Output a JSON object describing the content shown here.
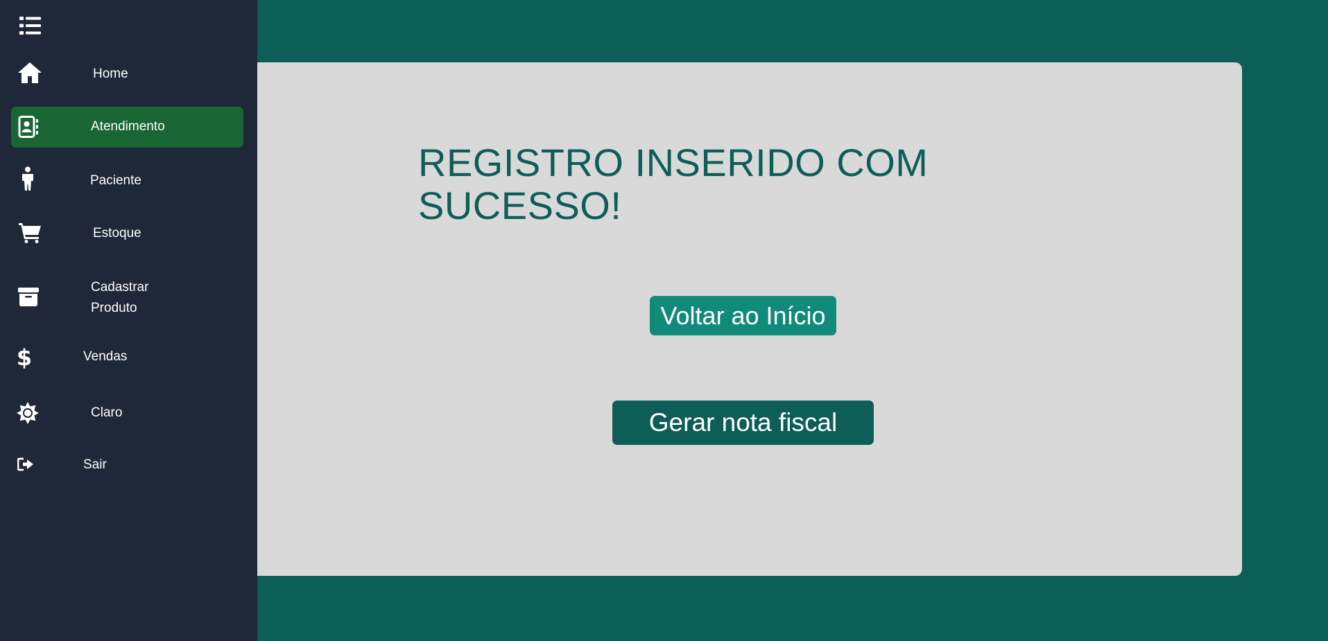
{
  "sidebar": {
    "toggle_icon": "list-icon",
    "items": [
      {
        "label": "Home",
        "icon": "home-icon",
        "active": false
      },
      {
        "label": "Atendimento",
        "icon": "contact-book-icon",
        "active": true
      },
      {
        "label": "Paciente",
        "icon": "person-icon",
        "active": false
      },
      {
        "label": "Estoque",
        "icon": "cart-icon",
        "active": false
      },
      {
        "label": "Cadastrar Produto",
        "icon": "archive-box-icon",
        "active": false
      },
      {
        "label": "Vendas",
        "icon": "dollar-icon",
        "active": false
      },
      {
        "label": "Claro",
        "icon": "sun-icon",
        "active": false
      },
      {
        "label": "Sair",
        "icon": "sign-out-icon",
        "active": false
      }
    ]
  },
  "main": {
    "message": "REGISTRO INSERIDO COM SUCESSO!",
    "home_button": "Voltar ao Início",
    "invoice_button": "Gerar nota fiscal"
  },
  "colors": {
    "background": "#0d5e56",
    "sidebar": "#1f2838",
    "active_item": "#196634",
    "panel": "#d9d9d9",
    "accent_button": "#128a7a"
  }
}
